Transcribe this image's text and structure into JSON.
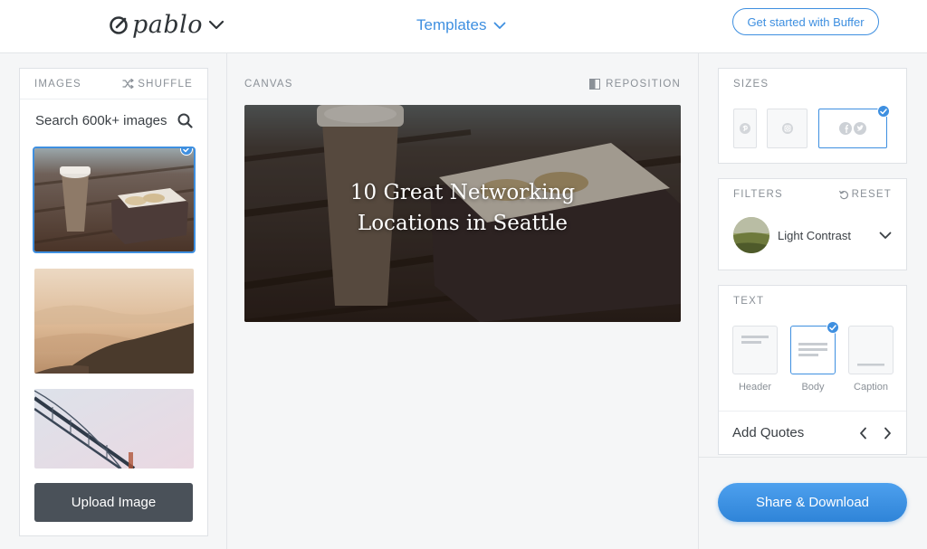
{
  "header": {
    "logo_text": "pablo",
    "templates_label": "Templates",
    "cta_label": "Get started with Buffer"
  },
  "images_panel": {
    "title": "IMAGES",
    "shuffle_label": "SHUFFLE",
    "search_placeholder": "Search 600k+ images",
    "upload_label": "Upload Image"
  },
  "canvas": {
    "title": "CANVAS",
    "reposition_label": "REPOSITION",
    "text_line1": "10 Great Networking",
    "text_line2": "Locations in Seattle"
  },
  "sizes": {
    "title": "SIZES",
    "options": [
      "pinterest-icon",
      "instagram-icon",
      "facebook-twitter-icon"
    ],
    "selected": "facebook-twitter-icon"
  },
  "filters": {
    "title": "FILTERS",
    "reset_label": "RESET",
    "selected_filter": "Light Contrast"
  },
  "text": {
    "title": "TEXT",
    "options": [
      "Header",
      "Body",
      "Caption"
    ],
    "selected": "Body",
    "add_quotes_label": "Add Quotes"
  },
  "share_label": "Share & Download",
  "colors": {
    "accent": "#3e8fe0",
    "dark_button": "#4a5159",
    "background": "#f5f6f7"
  }
}
